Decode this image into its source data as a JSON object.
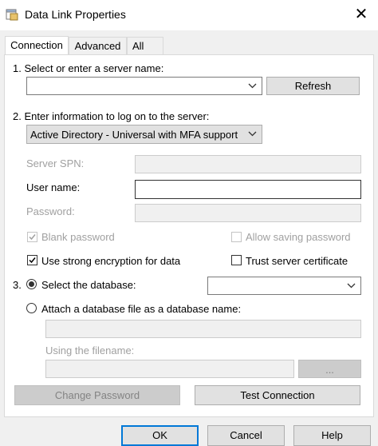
{
  "window": {
    "title": "Data Link Properties",
    "close_glyph": "✕"
  },
  "tabs": [
    {
      "label": "Connection"
    },
    {
      "label": "Advanced"
    },
    {
      "label": "All"
    }
  ],
  "step1": {
    "label": "1. Select or enter a server name:",
    "server_value": "",
    "refresh_label": "Refresh"
  },
  "step2": {
    "label": "2. Enter information to log on to the server:",
    "auth_selected": "Active Directory - Universal with MFA support",
    "server_spn_label": "Server SPN:",
    "user_name_label": "User name:",
    "password_label": "Password:",
    "blank_password_label": "Blank password",
    "allow_saving_label": "Allow saving password",
    "strong_encryption_label": "Use strong encryption for data",
    "trust_cert_label": "Trust server certificate"
  },
  "step3": {
    "number": "3.",
    "select_db_label": "Select the database:",
    "attach_db_label": "Attach a database file as a database name:",
    "using_filename_label": "Using the filename:",
    "browse_label": "..."
  },
  "buttons": {
    "change_password": "Change Password",
    "test_connection": "Test Connection",
    "ok": "OK",
    "cancel": "Cancel",
    "help": "Help"
  },
  "state": {
    "blank_password_checked": true,
    "allow_saving_checked": false,
    "strong_encryption_checked": true,
    "trust_cert_checked": false,
    "select_db_selected": true,
    "attach_db_selected": false
  },
  "colors": {
    "accent": "#0078d7",
    "dialog_bg": "#f0f0f0",
    "disabled_text": "#a0a0a0"
  }
}
